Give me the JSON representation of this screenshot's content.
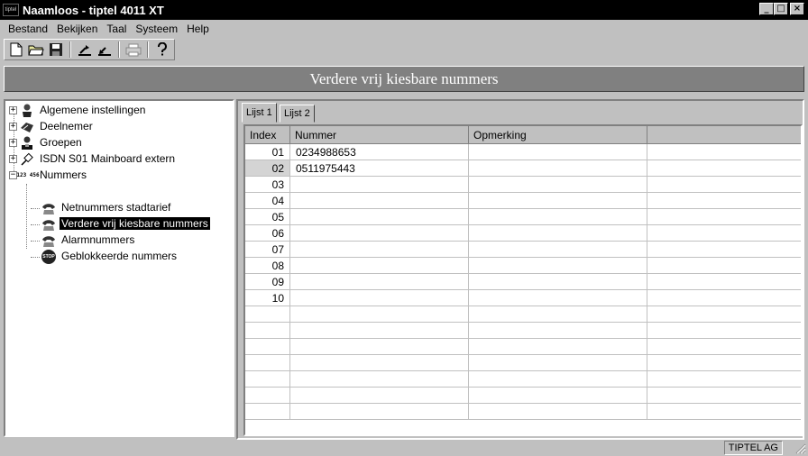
{
  "window": {
    "app_icon_text": "tiptel",
    "title": "Naamloos - tiptel 4011 XT",
    "minimize": "_",
    "maximize": "□",
    "close": "×"
  },
  "menu": [
    {
      "label": "Bestand"
    },
    {
      "label": "Bekijken"
    },
    {
      "label": "Taal"
    },
    {
      "label": "Systeem"
    },
    {
      "label": "Help"
    }
  ],
  "toolbar": {
    "icons": [
      "new-document-icon",
      "open-folder-icon",
      "save-disk-icon",
      "upload-icon",
      "download-icon",
      "print-icon",
      "help-icon"
    ]
  },
  "header": {
    "title": "Verdere vrij kiesbare nummers"
  },
  "tree": {
    "items": [
      {
        "label": "Algemene instellingen",
        "icon": "settings-person-icon",
        "expander": "+"
      },
      {
        "label": "Deelnemer",
        "icon": "subscriber-icon",
        "expander": "+"
      },
      {
        "label": "Groepen",
        "icon": "groups-icon",
        "expander": "+"
      },
      {
        "label": "ISDN S01 Mainboard extern",
        "icon": "isdn-plug-icon",
        "expander": "+"
      },
      {
        "label": "Nummers",
        "icon": "numbers-icon",
        "icon_text": "123 456",
        "expander": "−"
      },
      {
        "label": "Netnummers stadtarief",
        "icon": "phone-hand-icon"
      },
      {
        "label": "Verdere vrij kiesbare nummers",
        "icon": "phone-hand-icon",
        "selected": true
      },
      {
        "label": "Alarmnummers",
        "icon": "phone-hand-icon"
      },
      {
        "label": "Geblokkeerde nummers",
        "icon": "stop-icon",
        "icon_text": "STOP"
      }
    ]
  },
  "tabs": [
    {
      "label": "Lijst 1",
      "active": true
    },
    {
      "label": "Lijst 2",
      "active": false
    }
  ],
  "grid": {
    "columns": [
      "Index",
      "Nummer",
      "Opmerking",
      ""
    ],
    "rows": [
      {
        "index": "01",
        "nummer": "0234988653",
        "opmerking": ""
      },
      {
        "index": "02",
        "nummer": "0511975443",
        "opmerking": ""
      },
      {
        "index": "03",
        "nummer": "",
        "opmerking": ""
      },
      {
        "index": "04",
        "nummer": "",
        "opmerking": ""
      },
      {
        "index": "05",
        "nummer": "",
        "opmerking": ""
      },
      {
        "index": "06",
        "nummer": "",
        "opmerking": ""
      },
      {
        "index": "07",
        "nummer": "",
        "opmerking": ""
      },
      {
        "index": "08",
        "nummer": "",
        "opmerking": ""
      },
      {
        "index": "09",
        "nummer": "",
        "opmerking": ""
      },
      {
        "index": "10",
        "nummer": "",
        "opmerking": ""
      },
      {
        "index": "",
        "nummer": "",
        "opmerking": ""
      },
      {
        "index": "",
        "nummer": "",
        "opmerking": ""
      },
      {
        "index": "",
        "nummer": "",
        "opmerking": ""
      },
      {
        "index": "",
        "nummer": "",
        "opmerking": ""
      },
      {
        "index": "",
        "nummer": "",
        "opmerking": ""
      },
      {
        "index": "",
        "nummer": "",
        "opmerking": ""
      },
      {
        "index": "",
        "nummer": "",
        "opmerking": ""
      }
    ]
  },
  "status": {
    "company": "TIPTEL AG"
  }
}
